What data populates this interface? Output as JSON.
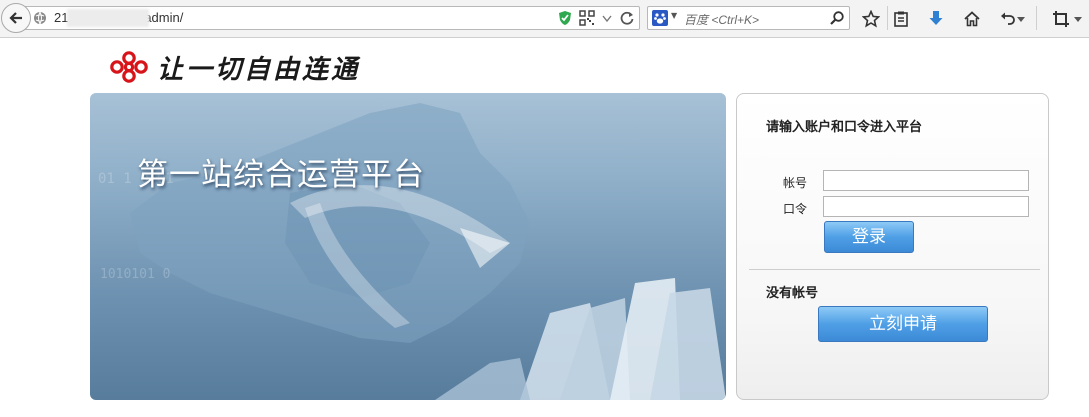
{
  "browser": {
    "url": "21            portaladmin/",
    "search_placeholder": "百度 <Ctrl+K>"
  },
  "header": {
    "slogan": "让一切自由连通"
  },
  "banner": {
    "title": "第一站综合运营平台"
  },
  "login": {
    "heading": "请输入账户和口令进入平台",
    "account_label": "帐号",
    "account_value": "",
    "password_label": "口令",
    "password_value": "",
    "login_button": "登录",
    "no_account_label": "没有帐号",
    "apply_button": "立刻申请"
  },
  "colors": {
    "brand_red": "#d7141a",
    "button_blue": "#4f9fe6",
    "banner_blue": "#6e92b1"
  }
}
